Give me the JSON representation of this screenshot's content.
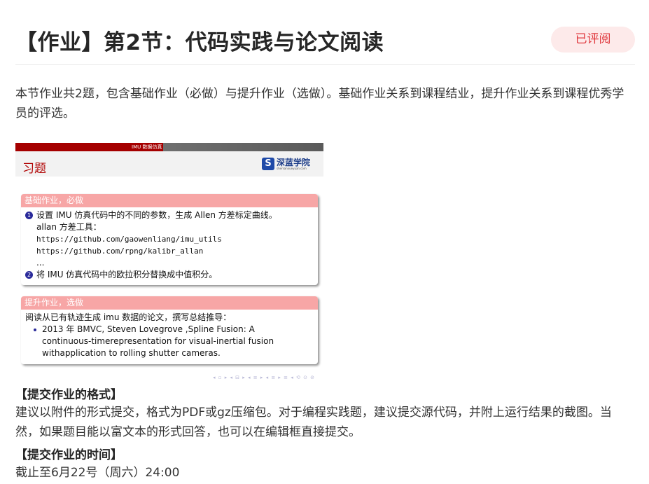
{
  "header": {
    "title": "【作业】第2节：代码实践与论文阅读",
    "status_badge": "已评阅"
  },
  "intro_text": "本节作业共2题，包含基础作业（必做）与提升作业（选做）。基础作业关系到课程结业，提升作业关系到课程优秀学员的评选。",
  "slide": {
    "top_bar_label": "IMU 数据仿真",
    "title": "习题",
    "logo_text": "深蓝学院",
    "logo_sub": "shenlanxueyuan.com",
    "basic_block": {
      "heading": "基础作业，必做",
      "item1_num": "1",
      "item1_text": "设置 IMU 仿真代码中的不同的参数，生成 Allen 方差标定曲线。",
      "tools_label": "allan 方差工具：",
      "link1": "https://github.com/gaowenliang/imu_utils",
      "link2": "https://github.com/rpng/kalibr_allan",
      "ellipsis": "...",
      "item2_num": "2",
      "item2_text": "将 IMU 仿真代码中的欧拉积分替换成中值积分。"
    },
    "advanced_block": {
      "heading": "提升作业，选做",
      "intro": "阅读从已有轨迹生成 imu 数据的论文，撰写总结推导：",
      "bullet_line1": "2013 年 BMVC, Steven Lovegrove ,Spline Fusion: A",
      "bullet_line2": "continuous-timerepresentation for visual-inertial fusion",
      "bullet_line3": "withapplication to rolling shutter cameras."
    },
    "nav_symbols": "◂ ▫ ▸ ◂ ⊟ ▸ ◂ ≡ ▸ ◂ ≡ ▸ ≡ ◂ ⟲ ⊙ ⊘"
  },
  "format_section": {
    "heading": "【提交作业的格式】",
    "text": "建议以附件的形式提交，格式为PDF或gz压缩包。对于编程实践题，建议提交源代码，并附上运行结果的截图。当然，如果题目能以富文本的形式回答，也可以在编辑框直接提交。"
  },
  "deadline_section": {
    "heading": "【提交作业的时间】",
    "text": "截止至6月22号（周六）24:00"
  },
  "colors": {
    "badge_text": "#e0393e",
    "badge_bg": "#fdeaea",
    "slide_red": "#a50000",
    "block_head": "#f7a6a6"
  }
}
